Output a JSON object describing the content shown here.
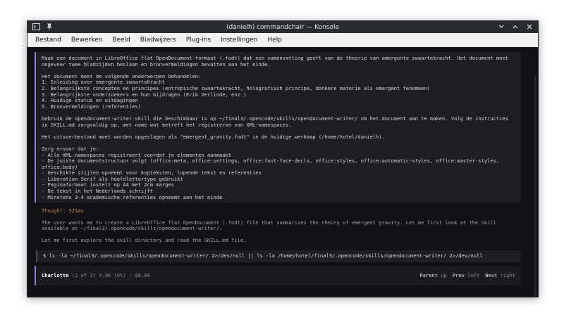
{
  "window": {
    "title": "(danielh) commandchair — Konsole"
  },
  "menu": {
    "items": [
      "Bestand",
      "Bewerken",
      "Beeld",
      "Bladwijzers",
      "Plug-ins",
      "Instellingen",
      "Help"
    ]
  },
  "prompt": {
    "text": "Maak een document in LibreOffice flat OpenDocument-formaat (.fodt) dat een samenvatting geeft van de theorie van emergente zwaartekracht. Het document moet ongeveer twee bladzijden beslaan en bronvermeldingen bevatten aan het einde.\n\nHet document moet de volgende onderwerpen behandelen:\n1. Inleiding over emergente zwaartekracht\n2. Belangrijkste concepten en principes (entropische zwaartekracht, holografisch principe, donkere materie als emergent fenomeen)\n3. Belangrijkste onderzoekers en hun bijdragen (Erik Verlinde, enz.)\n4. Huidige status en uitdagingen\n5. Bronvermeldingen (referenties)\n\nGebruik de opendocument-writer skill die beschikbaar is op ~/final3/.opencode/skills/opendocument-writer/ om het document aan te maken. Volg de instructies in SKILL.md zorgvuldig op, met name wat betreft het registreren van XML-namespaces.\n\nHet uitvoerbestand moet worden opgeslagen als \"emergent_gravity.fodt\" in de huidige werkmap (/home/hotel/danielh).\n\nZorg ervoor dat je:\n- Alle XML-namespaces registreert voordat je elementen aanmaakt\n- De juiste documentstructuur volgt (office:meta, office:settings, office:font-face-decls, office:styles, office:automatic-styles, office:master-styles, office:body)\n- Geschikte stijlen opneemt voor kopteksten, lopende tekst en referenties\n- Liberation Serif als hoofdlettertype gebruikt\n- Paginaformaat instelt op A4 met 2cm marges\n- De tekst in het Nederlands schrijft\n- Minstens 3-4 academische referenties opneemt aan het einde"
  },
  "thought": {
    "label": "Thought: 521ms",
    "line1": "The user wants me to create a LibreOffice flat OpenDocument (.fodt) file that summarizes the theory of emergent gravity. Let me first look at the skill available at ~/final3/.opencode/skills/opendocument-writer/.",
    "line2": "Let me first explore the skill directory and read the SKILL.md file."
  },
  "command": {
    "text": "$ ls -la ~/final3/.opencode/skills/opendocument-writer/ 2>/dev/null || ls -la /home/hotel/final3/.opencode/skills/opendocument-writer/ 2>/dev/null"
  },
  "status": {
    "agent": "Charlotte",
    "info": "(2 of 2) 4.9K (0%) · $0.00",
    "parent": "Parent",
    "parent_key": "up",
    "prev": "Prev",
    "prev_key": "left",
    "next": "Next",
    "next_key": "right"
  }
}
